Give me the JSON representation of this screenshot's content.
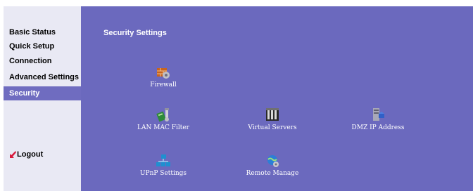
{
  "sidebar": {
    "items": [
      {
        "label": "Basic Status"
      },
      {
        "label": "Quick Setup"
      },
      {
        "label": "Connection"
      },
      {
        "label": "Advanced Settings"
      },
      {
        "label": "Security"
      }
    ],
    "logout_label": "Logout"
  },
  "main": {
    "title": "Security Settings",
    "tiles": [
      {
        "label": "Firewall",
        "icon": "firewall-icon"
      },
      {
        "label": "LAN MAC Filter",
        "icon": "mac-filter-icon"
      },
      {
        "label": "Virtual Servers",
        "icon": "servers-icon"
      },
      {
        "label": "DMZ IP Address",
        "icon": "dmz-icon"
      },
      {
        "label": "UPnP Settings",
        "icon": "upnp-icon"
      },
      {
        "label": "Remote Manage",
        "icon": "remote-manage-icon"
      }
    ]
  },
  "colors": {
    "main_bg": "#6b69be",
    "sidebar_bg": "#e9e9f4",
    "active_item_bg": "#6f6cc0",
    "logout_icon": "#d8193b"
  }
}
